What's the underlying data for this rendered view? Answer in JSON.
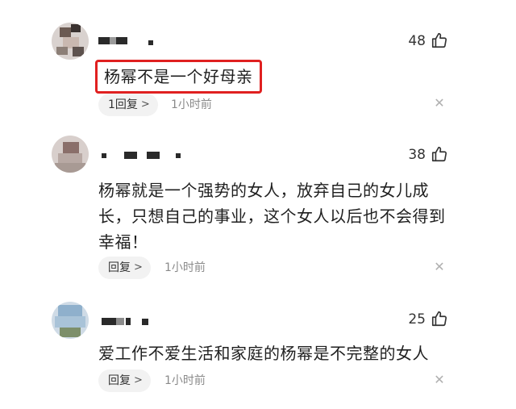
{
  "comments": [
    {
      "likes": "48",
      "text": "杨幂不是一个好母亲",
      "reply_label": "1回复",
      "time": "1小时前",
      "highlighted": true
    },
    {
      "likes": "38",
      "text": "杨幂就是一个强势的女人，放弃自己的女儿成长，只想自己的事业，这个女人以后也不会得到幸福！",
      "reply_label": "回复",
      "time": "1小时前",
      "highlighted": false
    },
    {
      "likes": "25",
      "text": "爱工作不爱生活和家庭的杨幂是不完整的女人",
      "reply_label": "回复",
      "time": "1小时前",
      "highlighted": false
    }
  ],
  "icons": {
    "like": "thumbs-up-icon",
    "reply_arrow": "chevron-right-icon",
    "dismiss": "close-icon",
    "avatar": "avatar-icon"
  },
  "colors": {
    "highlight_border": "#e02020",
    "meta_text": "#8a8a8a",
    "pill_bg": "#f2f2f2"
  }
}
